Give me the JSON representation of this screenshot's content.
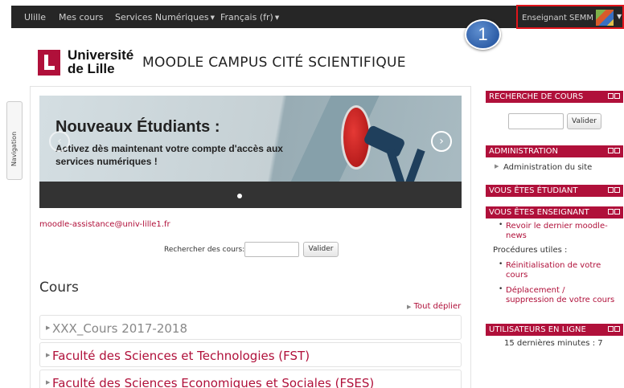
{
  "topnav": {
    "home": "Ulille",
    "my_courses": "Mes cours",
    "services": "Services Numériques",
    "language": "Français (fr)",
    "user_name": "Enseignant SEMM"
  },
  "annotation": {
    "step_number": "1"
  },
  "header": {
    "university_line1": "Université",
    "university_line2": "de Lille",
    "site_title": "MOODLE CAMPUS CITÉ SCIENTIFIQUE"
  },
  "side_tab": {
    "label": "Navigation"
  },
  "banner": {
    "heading": "Nouveaux Étudiants :",
    "text": "Activez dès maintenant votre compte d'accès aux services numériques !"
  },
  "main": {
    "email": "moodle-assistance@univ-lille1.fr",
    "search_label": "Rechercher des cours:",
    "search_button": "Valider",
    "courses_heading": "Cours",
    "expand_all": "Tout déplier",
    "categories": [
      {
        "label": "XXX_Cours 2017-2018",
        "color": "#888888"
      },
      {
        "label": "Faculté des Sciences et Technologies (FST)",
        "color": "#b0103a"
      },
      {
        "label": "Faculté des Sciences Economiques et Sociales (FSES)",
        "color": "#b0103a"
      }
    ]
  },
  "sidebar": {
    "course_search": {
      "title": "RECHERCHE DE COURS",
      "button": "Valider"
    },
    "admin": {
      "title": "ADMINISTRATION",
      "link": "Administration du site"
    },
    "student": {
      "title": "VOUS ÊTES ÉTUDIANT"
    },
    "teacher": {
      "title": "VOUS ÊTES ENSEIGNANT",
      "link1_line1": "Revoir le dernier moodle-",
      "link1_line2": "news",
      "procedures": "Procédures utiles :",
      "link2_line1": "Réinitialisation de votre",
      "link2_line2": "cours",
      "link3_line1": "Déplacement /",
      "link3_line2": "suppression de votre cours"
    },
    "online": {
      "title": "UTILISATEURS EN LIGNE",
      "text": "15 dernières minutes : 7"
    }
  },
  "colors": {
    "brand": "#b0103a",
    "topbar": "#262626",
    "highlight": "#e0141b",
    "badge": "#2f5fa8"
  }
}
